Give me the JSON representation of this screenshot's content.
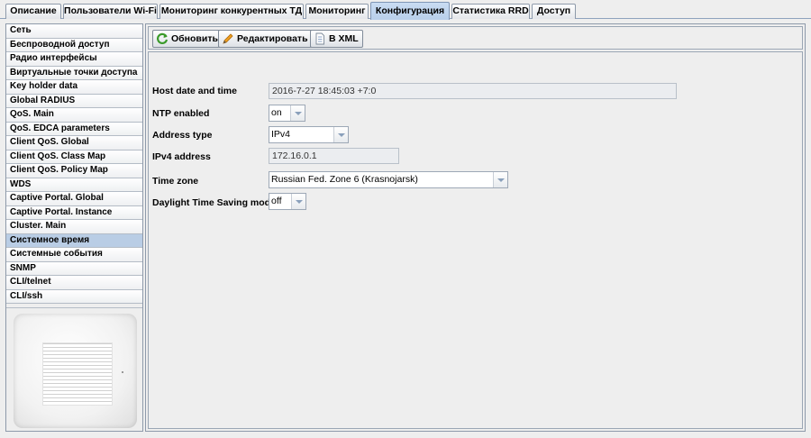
{
  "tabs": [
    {
      "label": "Описание"
    },
    {
      "label": "Пользователи Wi-Fi"
    },
    {
      "label": "Мониторинг конкурентных ТД"
    },
    {
      "label": "Мониторинг"
    },
    {
      "label": "Конфигурация",
      "active": true
    },
    {
      "label": "Статистика RRD"
    },
    {
      "label": "Доступ"
    }
  ],
  "sidebar": {
    "items": [
      {
        "label": "Сеть"
      },
      {
        "label": "Беспроводной доступ"
      },
      {
        "label": "Радио интерфейсы"
      },
      {
        "label": "Виртуальные точки доступа"
      },
      {
        "label": "Key holder data"
      },
      {
        "label": "Global RADIUS"
      },
      {
        "label": "QoS. Main"
      },
      {
        "label": "QoS. EDCA parameters"
      },
      {
        "label": "Client QoS. Global"
      },
      {
        "label": "Client QoS. Class Map"
      },
      {
        "label": "Client QoS. Policy Map"
      },
      {
        "label": "WDS"
      },
      {
        "label": "Captive Portal. Global"
      },
      {
        "label": "Captive Portal. Instance"
      },
      {
        "label": "Cluster. Main"
      },
      {
        "label": "Системное время",
        "selected": true
      },
      {
        "label": "Системные события"
      },
      {
        "label": "SNMP"
      },
      {
        "label": "CLI/telnet"
      },
      {
        "label": "CLI/ssh"
      }
    ]
  },
  "toolbar": {
    "refresh_label": "Обновить",
    "edit_label": "Редактировать",
    "xml_label": "В XML"
  },
  "form": {
    "host_date": {
      "label": "Host date and time",
      "value": "2016-7-27 18:45:03 +7:0"
    },
    "ntp": {
      "label": "NTP enabled",
      "value": "on"
    },
    "address_type": {
      "label": "Address type",
      "value": "IPv4"
    },
    "ipv4": {
      "label": "IPv4 address",
      "value": "172.16.0.1"
    },
    "timezone": {
      "label": "Time zone",
      "value": "Russian Fed. Zone 6 (Krasnojarsk)"
    },
    "dst": {
      "label": "Daylight Time Saving mode",
      "value": "off"
    }
  },
  "colors": {
    "active_tab": "#b8cfea",
    "selected_item": "#b9cde5",
    "refresh_icon": "#3a9a2a",
    "edit_icon": "#e08a10"
  }
}
